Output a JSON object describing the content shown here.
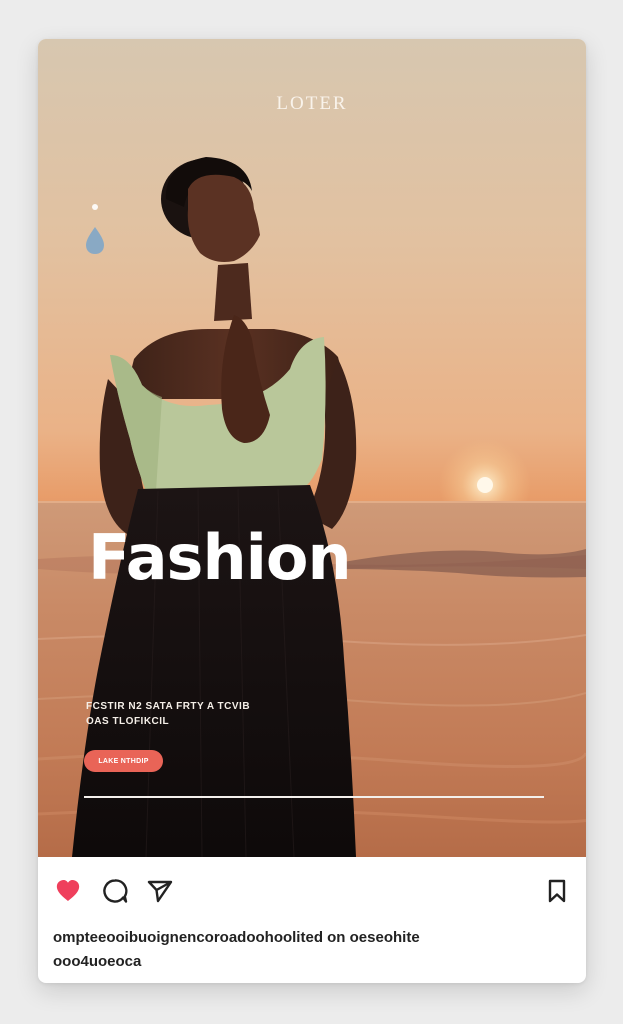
{
  "post": {
    "brand": "LOTER",
    "headline": "Fashion",
    "subtext_line1": "FCSTIR N2 SATA FRTY A TCVIB",
    "subtext_line2": "OAS TLOFIKCIL",
    "cta_label": "LAKE NTHDIP",
    "progress": 1.0,
    "caption_line1": "ompteeooibuoignencoroadoohoolited on oeseohite",
    "caption_line2": "ooo4uoeoca"
  },
  "actions": {
    "like_icon": "heart-filled-icon",
    "comment_icon": "comment-icon",
    "share_icon": "send-icon",
    "save_icon": "bookmark-icon"
  },
  "colors": {
    "like": "#ef3f5c",
    "cta": "#e96457",
    "icon": "#222222"
  }
}
